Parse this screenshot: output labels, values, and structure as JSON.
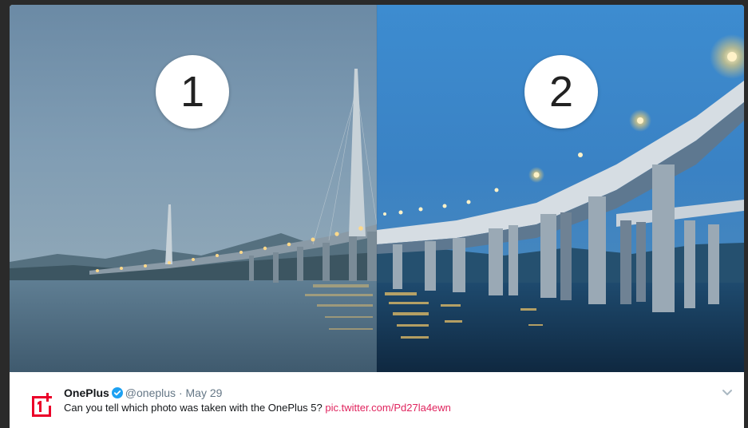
{
  "photo": {
    "left_badge": "1",
    "right_badge": "2"
  },
  "tweet": {
    "author_name": "OnePlus",
    "handle": "@oneplus",
    "separator": "·",
    "date": "May 29",
    "text": "Can you tell which photo was taken with the OnePlus 5?",
    "link_text": "pic.twitter.com/Pd27la4ewn"
  },
  "colors": {
    "brand": "#eb0029",
    "link": "#e0245e",
    "verified": "#1da1f2"
  },
  "icons": {
    "logo": "oneplus-logo-icon",
    "verified": "verified-badge-icon",
    "menu": "chevron-down-icon"
  }
}
